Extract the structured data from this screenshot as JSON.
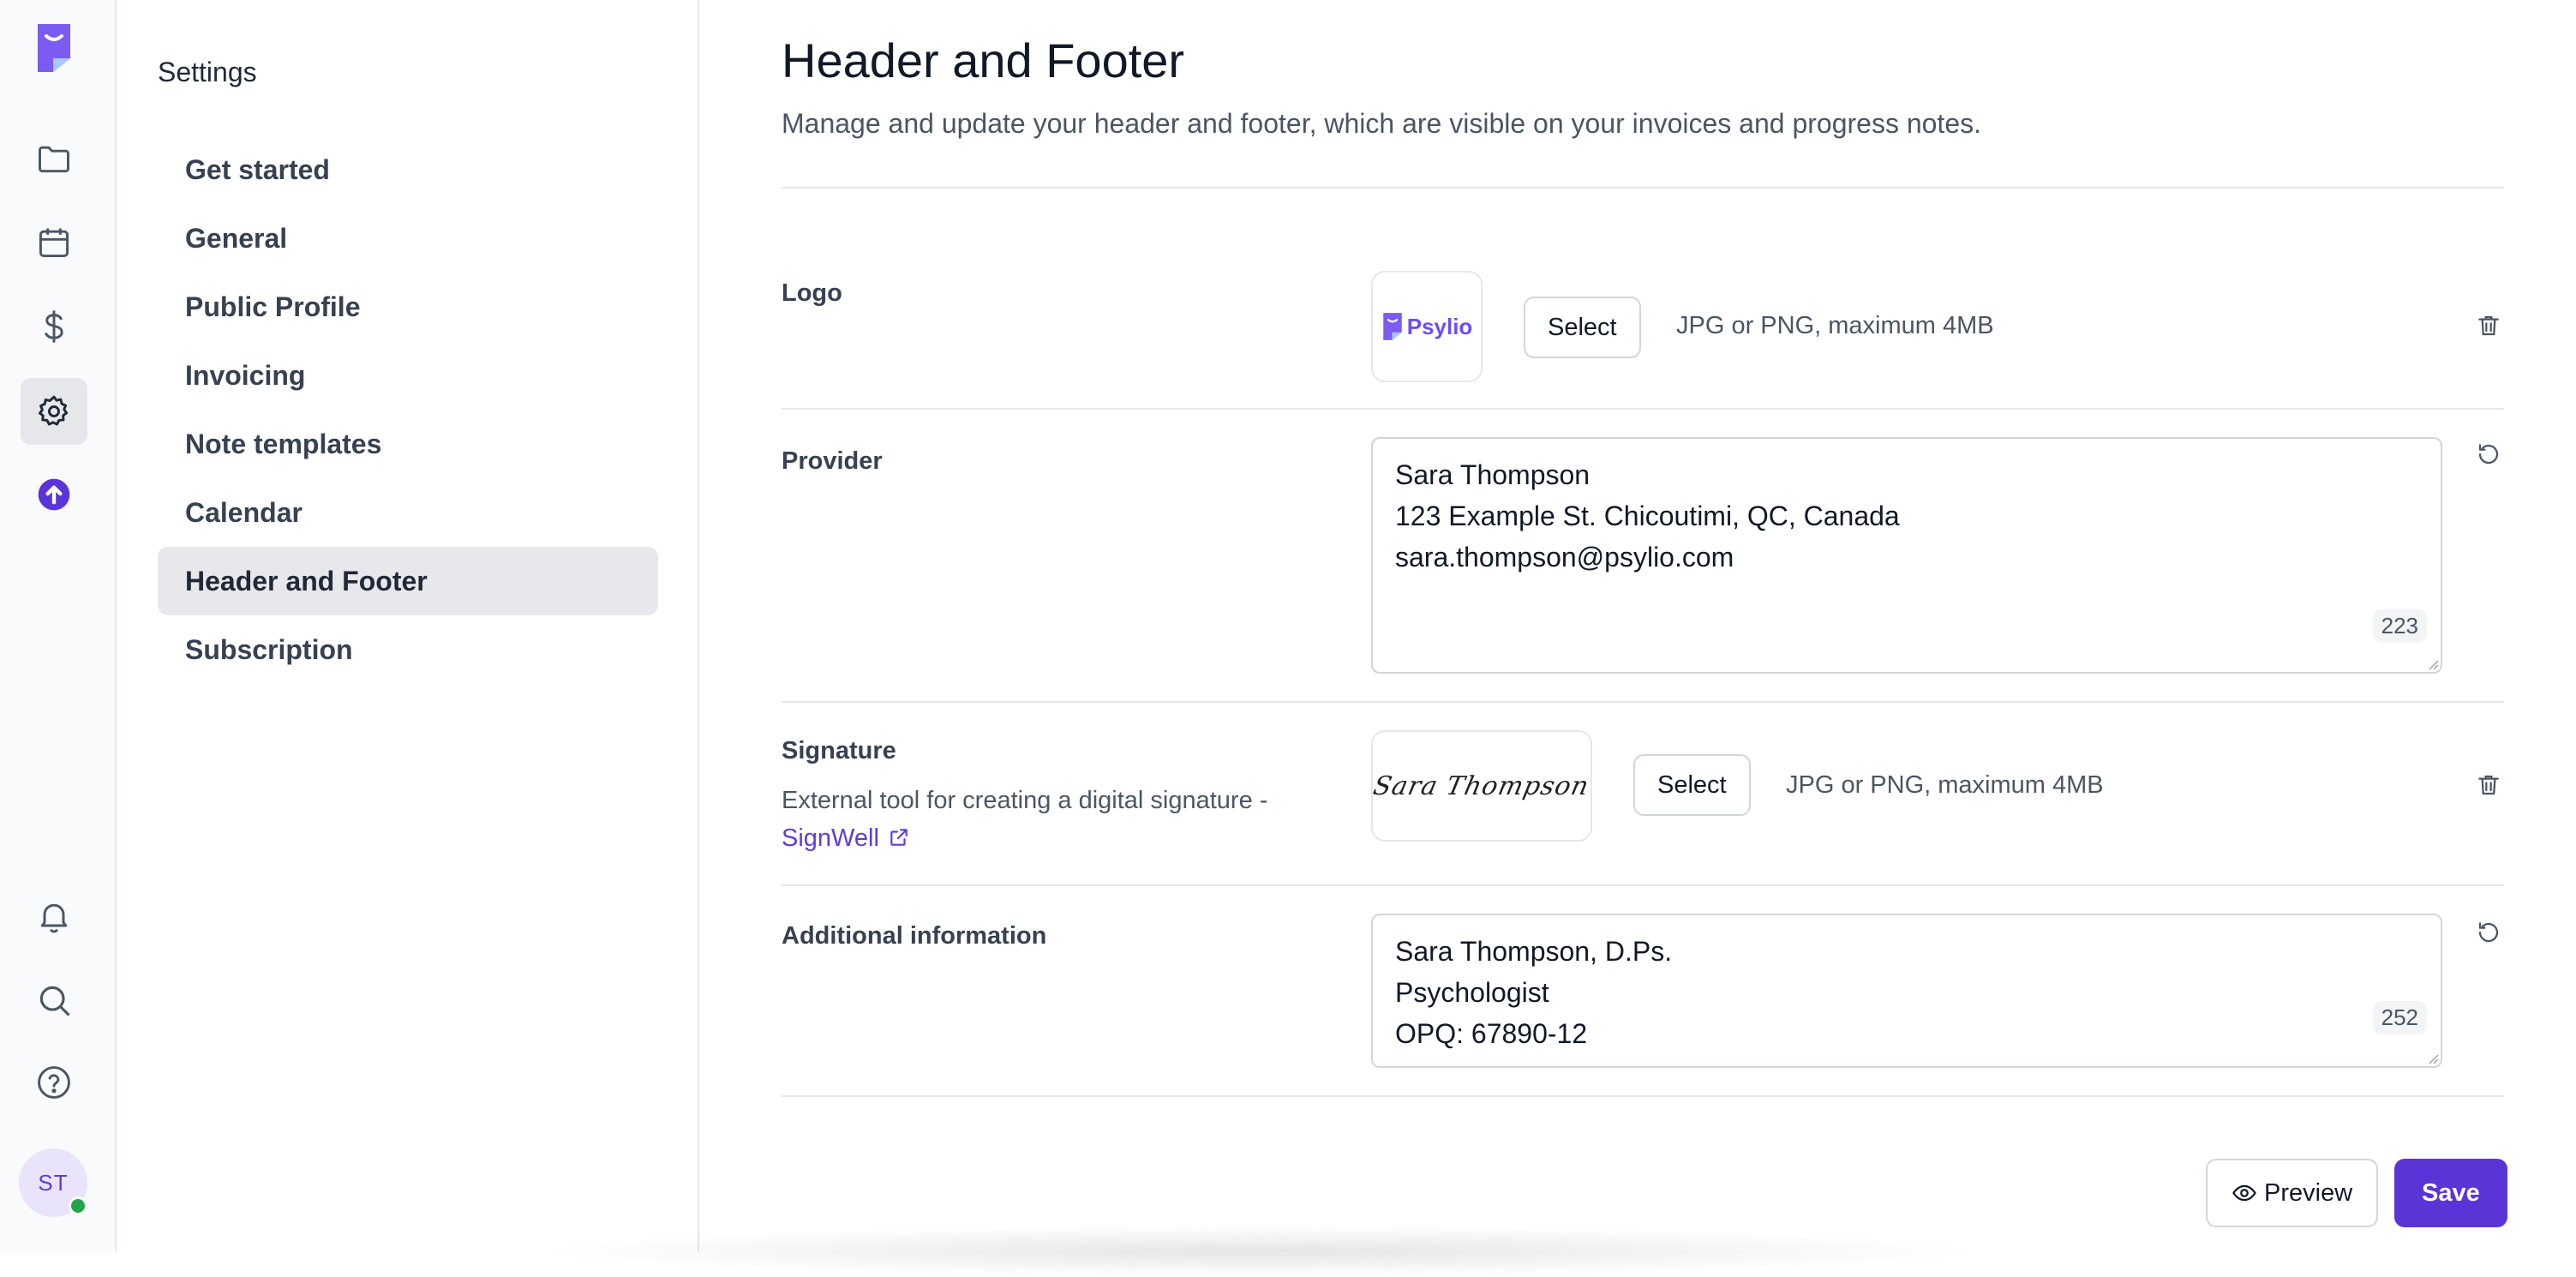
{
  "rail": {
    "icons": [
      "app-logo",
      "folder-icon",
      "calendar-icon",
      "dollar-icon",
      "gear-icon",
      "upgrade-icon",
      "bell-icon",
      "search-icon",
      "help-icon"
    ],
    "avatar_initials": "ST",
    "accent": "#5b34d8"
  },
  "settings": {
    "title": "Settings",
    "items": [
      {
        "label": "Get started"
      },
      {
        "label": "General"
      },
      {
        "label": "Public Profile"
      },
      {
        "label": "Invoicing"
      },
      {
        "label": "Note templates"
      },
      {
        "label": "Calendar"
      },
      {
        "label": "Header and Footer",
        "active": true
      },
      {
        "label": "Subscription"
      }
    ]
  },
  "page": {
    "title": "Header and Footer",
    "subtitle": "Manage and update your header and footer, which are visible on your invoices and progress notes."
  },
  "logo": {
    "label": "Logo",
    "logo_text": "Psylio",
    "select_label": "Select",
    "hint": "JPG or PNG, maximum 4MB"
  },
  "provider": {
    "label": "Provider",
    "value": "Sara Thompson\n123 Example St. Chicoutimi, QC, Canada\nsara.thompson@psylio.com",
    "counter": "223"
  },
  "signature": {
    "label": "Signature",
    "help": "External tool for creating a digital signature -",
    "link": "SignWell",
    "signature_text": "Sara Thompson",
    "select_label": "Select",
    "hint": "JPG or PNG, maximum 4MB"
  },
  "additional": {
    "label": "Additional information",
    "value": "Sara Thompson, D.Ps.\nPsychologist\nOPQ: 67890-12",
    "counter": "252"
  },
  "actions": {
    "preview_label": "Preview",
    "save_label": "Save"
  }
}
